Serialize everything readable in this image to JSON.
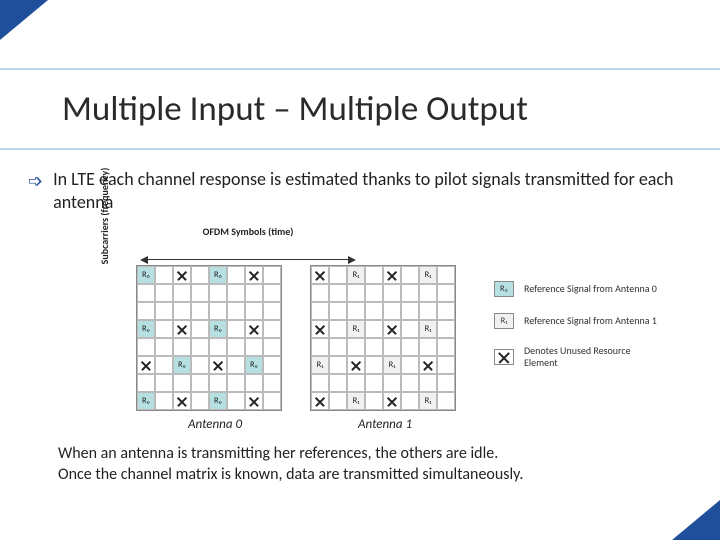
{
  "title": "Multiple Input – Multiple Output",
  "bullet": "In LTE each channel response is estimated thanks to pilot signals transmitted for each antenna",
  "diagram": {
    "time_axis_label": "OFDM Symbols (time)",
    "freq_axis_label": "Subcarriers (frequency)",
    "antenna0_label": "Antenna 0",
    "antenna1_label": "Antenna 1",
    "cell_r0": "R₀",
    "cell_r1": "R₁",
    "legend": {
      "r0": "Reference Signal from Antenna 0",
      "r1": "Reference Signal from Antenna 1",
      "x": "Denotes Unused Resource Element"
    }
  },
  "footer_line1": "When an antenna is transmitting her references, the others are idle.",
  "footer_line2": "Once the channel matrix is known, data are transmitted simultaneously."
}
